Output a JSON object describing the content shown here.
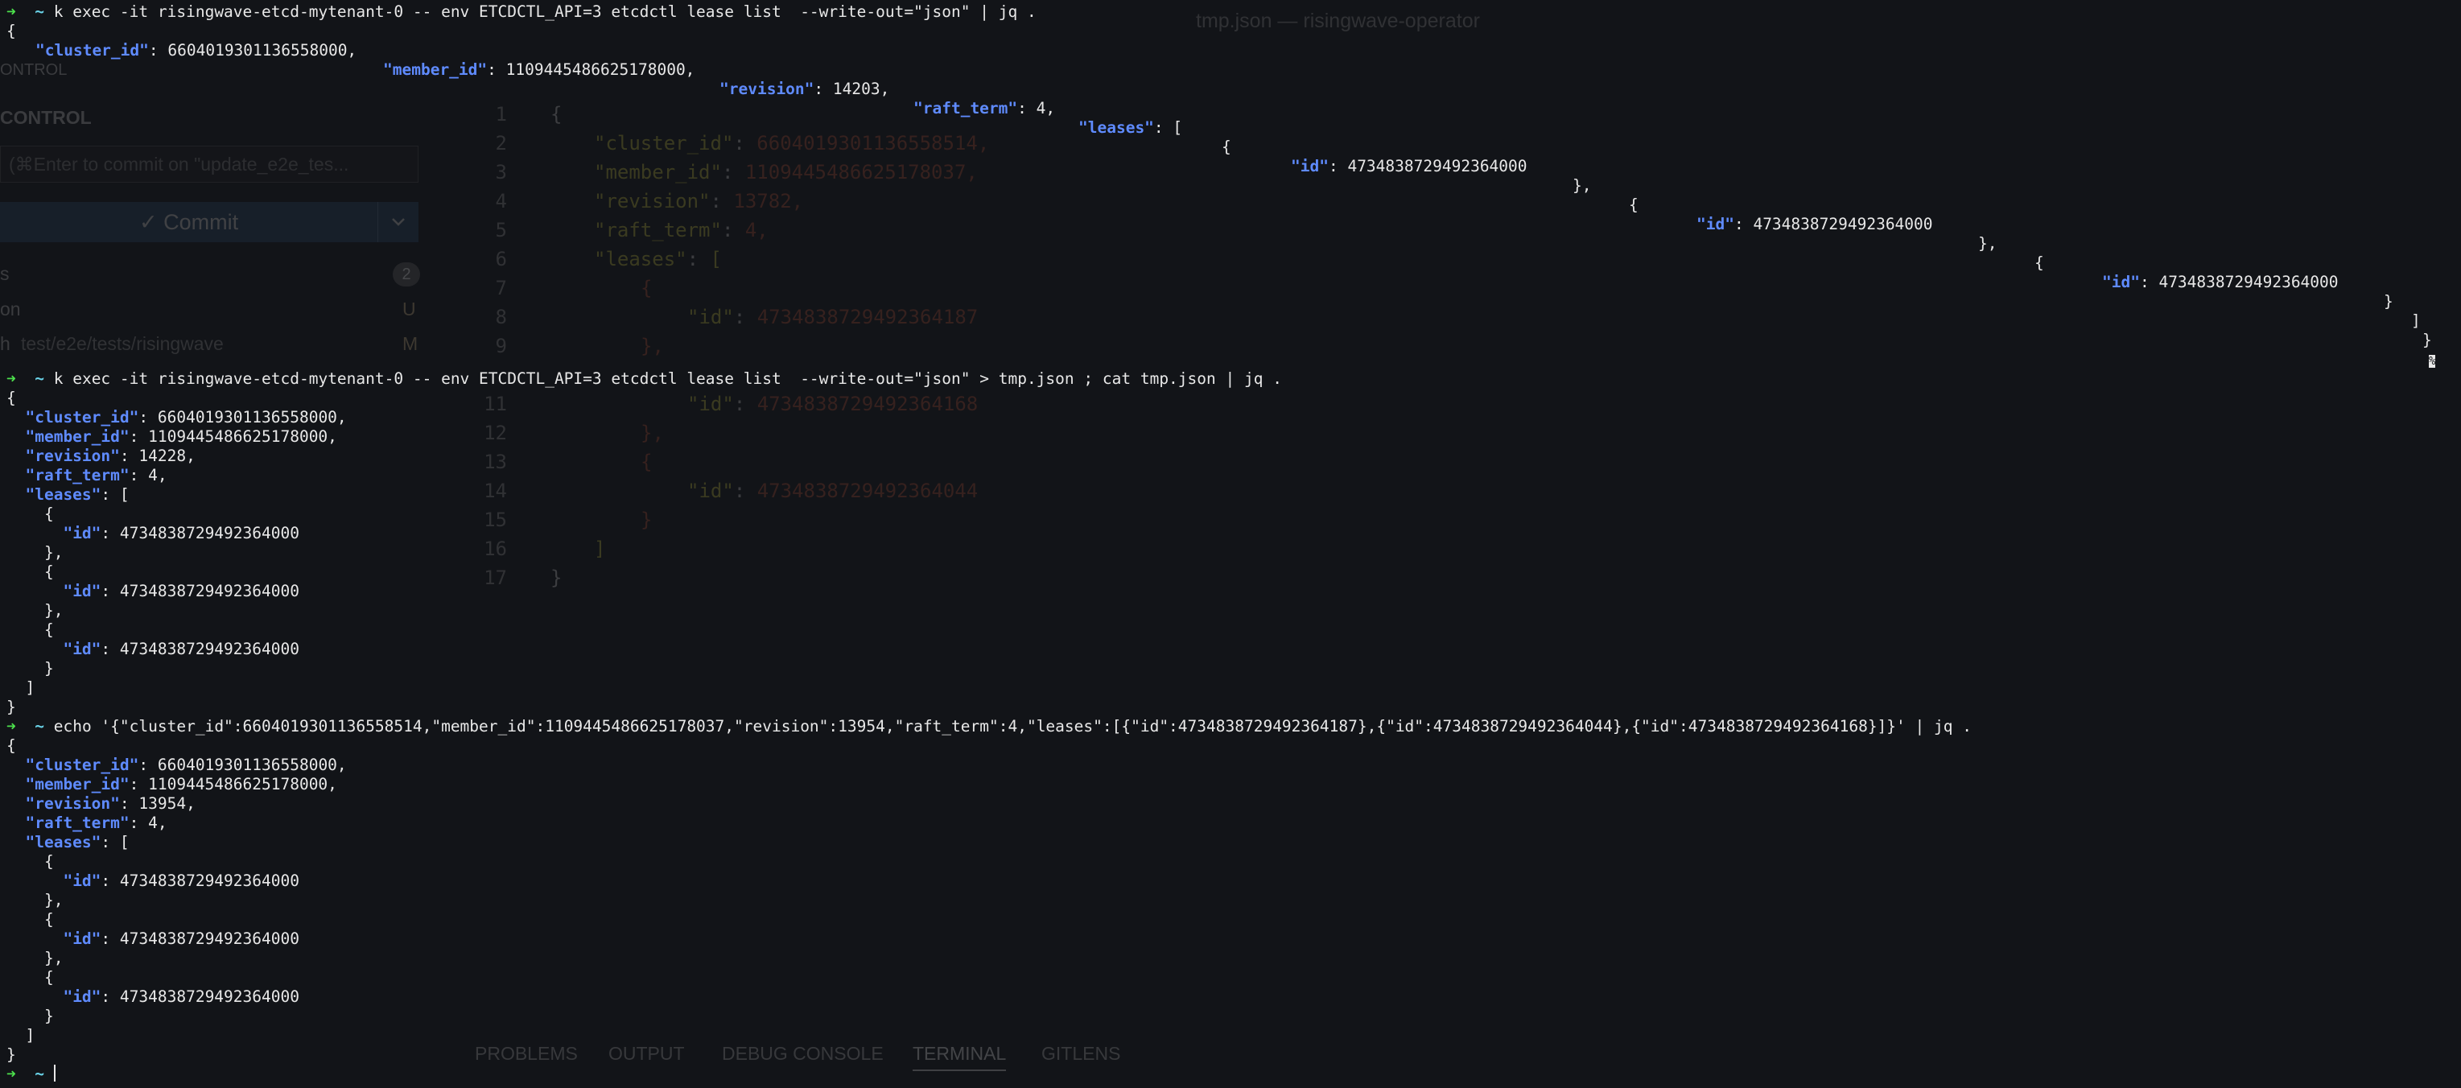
{
  "window": {
    "title": "tmp.json — risingwave-operator"
  },
  "source_control": {
    "header_partial": "ONTROL",
    "section_title": "CONTROL",
    "commit_input_placeholder": "(⌘Enter to commit on \"update_e2e_tes...",
    "commit_button_label": "✓ Commit",
    "changes_badge": "2",
    "files": [
      {
        "name": "s",
        "status": ""
      },
      {
        "name": "on",
        "status": "U"
      },
      {
        "name": "h",
        "path": "test/e2e/tests/risingwave",
        "status": "M"
      }
    ]
  },
  "editor": {
    "lines": [
      {
        "n": "1",
        "text": "{"
      },
      {
        "n": "2",
        "key": "\"cluster_id\"",
        "val": "6604019301136558514,"
      },
      {
        "n": "3",
        "key": "\"member_id\"",
        "val": "1109445486625178037,"
      },
      {
        "n": "4",
        "key": "\"revision\"",
        "val": "13782,"
      },
      {
        "n": "5",
        "key": "\"raft_term\"",
        "val": "4,"
      },
      {
        "n": "6",
        "key": "\"leases\"",
        "val": "["
      },
      {
        "n": "7",
        "text": "{"
      },
      {
        "n": "8",
        "key": "\"id\"",
        "val": "4734838729492364187"
      },
      {
        "n": "9",
        "text": "},"
      },
      {
        "n": "11",
        "key": "\"id\"",
        "val": "4734838729492364168"
      },
      {
        "n": "12",
        "text": "},"
      },
      {
        "n": "13",
        "text": "{"
      },
      {
        "n": "14",
        "key": "\"id\"",
        "val": "4734838729492364044"
      },
      {
        "n": "15",
        "text": "}"
      },
      {
        "n": "16",
        "text": "]"
      },
      {
        "n": "17",
        "text": "}"
      }
    ]
  },
  "panel": {
    "tabs": [
      "PROBLEMS",
      "OUTPUT",
      "DEBUG CONSOLE",
      "TERMINAL",
      "GITLENS"
    ],
    "active_tab": "TERMINAL"
  },
  "terminal": {
    "prompt_arrow": "➜",
    "prompt_dir": "~",
    "cmd1": "k exec -it risingwave-etcd-mytenant-0 -- env ETCDCTL_API=3 etcdctl lease list  --write-out=\"json\" | jq .",
    "cmd2": "k exec -it risingwave-etcd-mytenant-0 -- env ETCDCTL_API=3 etcdctl lease list  --write-out=\"json\" > tmp.json ; cat tmp.json | jq .",
    "cmd3": "echo '{\"cluster_id\":6604019301136558514,\"member_id\":1109445486625178037,\"revision\":13954,\"raft_term\":4,\"leases\":[{\"id\":4734838729492364187},{\"id\":4734838729492364044},{\"id\":4734838729492364168}]}' | jq .",
    "key_cluster_id": "\"cluster_id\"",
    "key_member_id": "\"member_id\"",
    "key_revision": "\"revision\"",
    "key_raft_term": "\"raft_term\"",
    "key_leases": "\"leases\"",
    "key_id": "\"id\"",
    "out1": {
      "cluster_id": "6604019301136558000,",
      "member_id": "1109445486625178000,",
      "revision": "14203,",
      "raft_term": "4,",
      "lease_id": "4734838729492364000"
    },
    "out2": {
      "cluster_id": "6604019301136558000,",
      "member_id": "1109445486625178000,",
      "revision": "14228,",
      "raft_term": "4,",
      "lease_ids": [
        "4734838729492364000",
        "4734838729492364000",
        "4734838729492364000"
      ]
    },
    "out3": {
      "cluster_id": "6604019301136558000,",
      "member_id": "1109445486625178000,",
      "revision": "13954,",
      "raft_term": "4,",
      "lease_ids": [
        "4734838729492364000",
        "4734838729492364000",
        "4734838729492364000"
      ]
    },
    "percent_marker": "%"
  }
}
